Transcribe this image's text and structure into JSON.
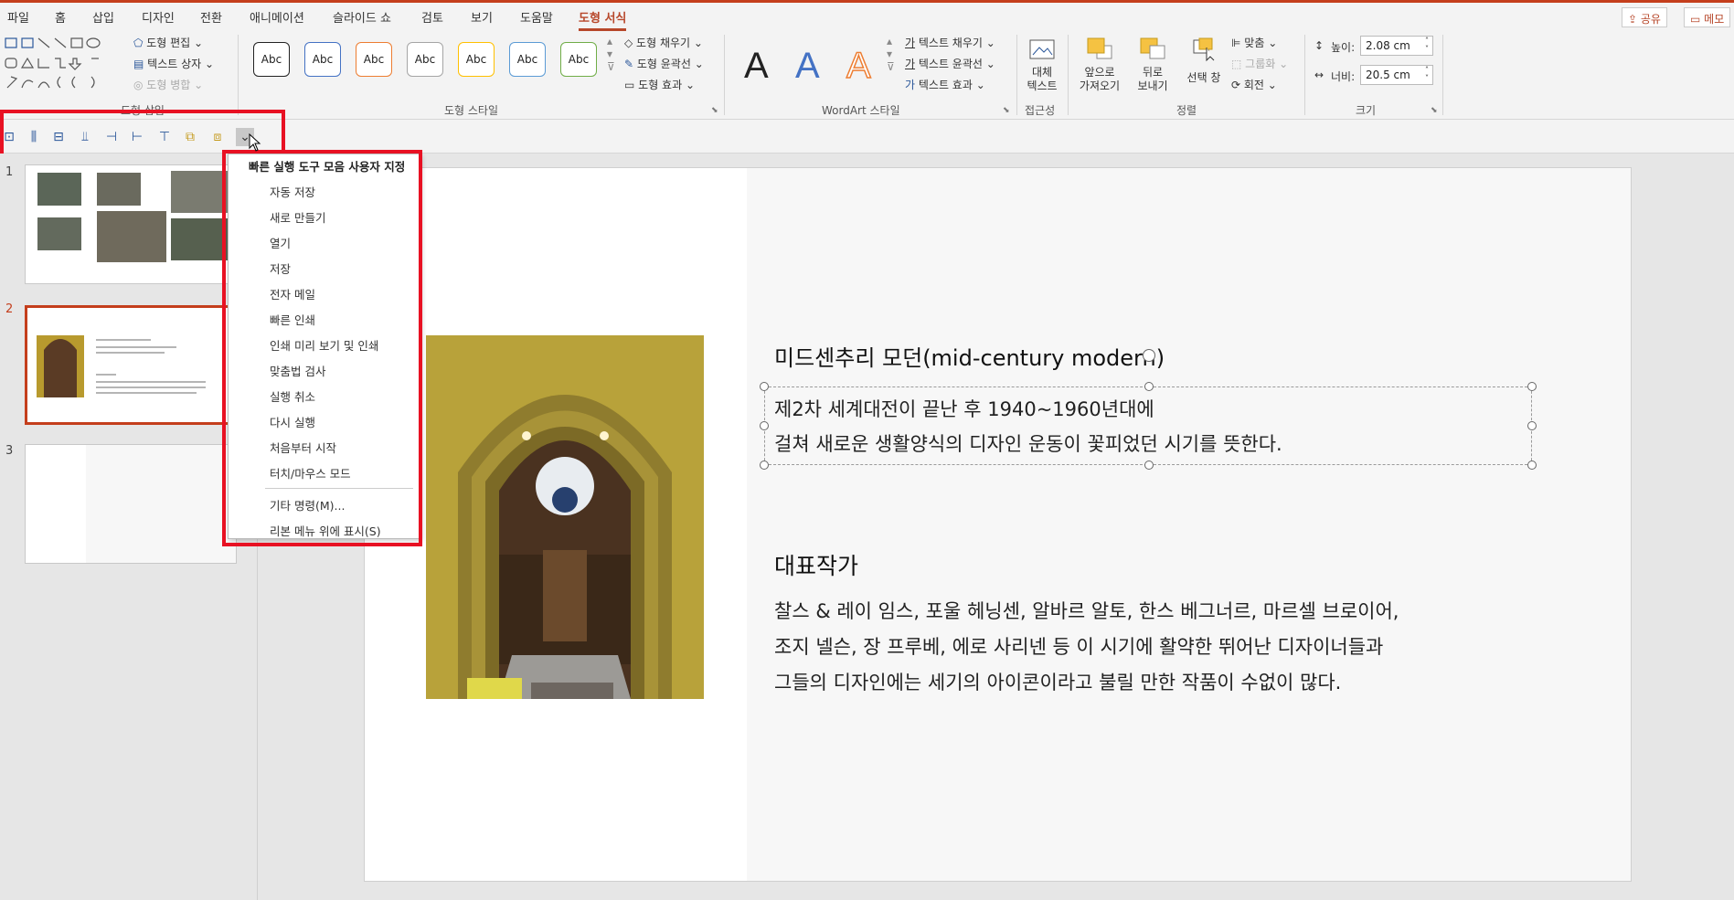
{
  "menu": {
    "tabs": [
      "파일",
      "홈",
      "삽입",
      "디자인",
      "전환",
      "애니메이션",
      "슬라이드 쇼",
      "검토",
      "보기",
      "도움말",
      "도형 서식"
    ],
    "active_tab": "도형 서식",
    "share": "공유",
    "memo": "메모"
  },
  "ribbon": {
    "insert_shapes": {
      "label": "도형 삽입",
      "edit_shape": "도형 편집",
      "text_box": "텍스트 상자",
      "merge_shapes": "도형 병합"
    },
    "shape_styles": {
      "label": "도형 스타일",
      "samples": [
        "Abc",
        "Abc",
        "Abc",
        "Abc",
        "Abc",
        "Abc",
        "Abc"
      ],
      "sample_colors": [
        "#222222",
        "#4472c4",
        "#ed7d31",
        "#a5a5a5",
        "#ffc000",
        "#5b9bd5",
        "#70ad47"
      ],
      "fill": "도형 채우기",
      "outline": "도형 윤곽선",
      "effects": "도형 효과"
    },
    "wordart": {
      "label": "WordArt 스타일",
      "letters": [
        "A",
        "A",
        "A"
      ],
      "letter_colors": [
        "#000000",
        "#4472c4",
        "#ed7d31"
      ],
      "text_fill": "텍스트 채우기",
      "text_outline": "텍스트 윤곽선",
      "text_effects": "텍스트 효과"
    },
    "accessibility": {
      "label": "접근성",
      "alt_text_1": "대체",
      "alt_text_2": "텍스트"
    },
    "arrange": {
      "label": "정렬",
      "bring_forward_1": "앞으로",
      "bring_forward_2": "가져오기",
      "send_backward_1": "뒤로",
      "send_backward_2": "보내기",
      "selection_pane": "선택 창",
      "align": "맞춤",
      "group": "그룹화",
      "rotate": "회전"
    },
    "size": {
      "label": "크기",
      "height_label": "높이:",
      "height_value": "2.08 cm",
      "width_label": "너비:",
      "width_value": "20.5 cm"
    }
  },
  "qat_menu": {
    "header": "빠른 실행 도구 모음 사용자 지정",
    "items": [
      "자동 저장",
      "새로 만들기",
      "열기",
      "저장",
      "전자 메일",
      "빠른 인쇄",
      "인쇄 미리 보기 및 인쇄",
      "맞춤법 검사",
      "실행 취소",
      "다시 실행",
      "처음부터 시작",
      "터치/마우스 모드"
    ],
    "more_commands": "기타 명령(M)...",
    "show_above_ribbon": "리본 메뉴 위에 표시(S)"
  },
  "thumbnails": {
    "numbers": [
      "1",
      "2",
      "3"
    ],
    "selected": "2"
  },
  "slide": {
    "title": "미드센추리 모던(mid-century modern)",
    "para1_line1": "제2차 세계대전이 끝난 후 1940~1960년대에",
    "para1_line2": "걸쳐 새로운 생활양식의 디자인 운동이 꽃피었던 시기를 뜻한다.",
    "heading2": "대표작가",
    "para2_line1": "찰스 & 레이 임스, 포울 헤닝센, 알바르 알토, 한스 베그너르, 마르셀 브로이어,",
    "para2_line2": "조지 넬슨, 장 프루베, 에로 사리넨 등 이 시기에 활약한 뛰어난 디자이너들과",
    "para2_line3": "그들의 디자인에는 세기의 아이콘이라고 불릴 만한 작품이 수없이 많다."
  },
  "colors": {
    "accent": "#b7472a",
    "highlight_box": "#e81123"
  }
}
